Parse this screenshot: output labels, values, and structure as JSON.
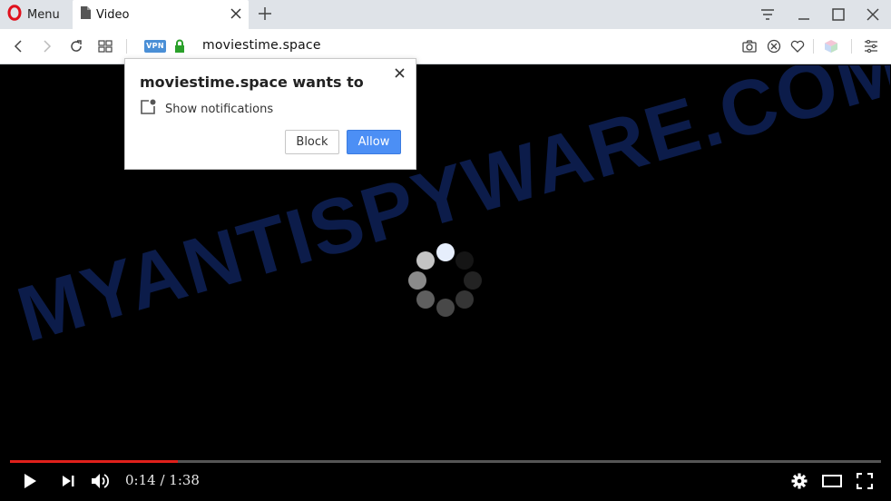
{
  "browser": {
    "menu_label": "Menu",
    "tab": {
      "title": "Video"
    },
    "address": {
      "vpn_badge": "VPN",
      "url": "moviestime.space"
    }
  },
  "page": {
    "watermark": "MYANTISPYWARE.COM"
  },
  "player": {
    "current_time": "0:14",
    "duration": "1:38",
    "timecode": "0:14 / 1:38",
    "progress": 0.193,
    "accent_color": "#e0201b"
  },
  "notification": {
    "title": "moviestime.space wants to",
    "permission": "Show notifications",
    "block_label": "Block",
    "allow_label": "Allow",
    "allow_color": "#4c8ff5"
  },
  "icons": [
    "opera-logo-icon",
    "page-icon",
    "close-icon",
    "plus-icon",
    "menu-lines-icon",
    "minimize-icon",
    "maximize-icon",
    "back-icon",
    "forward-icon",
    "reload-icon",
    "speed-dial-icon",
    "lock-icon",
    "camera-icon",
    "block-icon",
    "heart-icon",
    "cube-icon",
    "settings-icon",
    "play-icon",
    "next-icon",
    "volume-icon",
    "gear-icon",
    "theater-icon",
    "fullscreen-icon",
    "notification-icon",
    "loading-spinner-icon"
  ]
}
